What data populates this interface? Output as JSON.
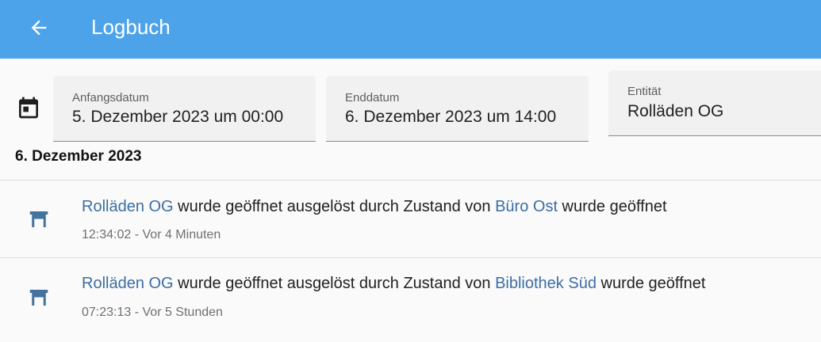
{
  "header": {
    "title": "Logbuch",
    "back_icon": "arrow-left-icon",
    "background": "#4da3ea"
  },
  "filters": {
    "calendar_icon": "calendar-icon",
    "start_label": "Anfangsdatum",
    "start_value": "5. Dezember 2023 um 00:00",
    "end_label": "Enddatum",
    "end_value": "6. Dezember 2023 um 14:00",
    "entity_label": "Entität",
    "entity_value": "Rolläden OG"
  },
  "day_heading": "6. Dezember 2023",
  "entries": [
    {
      "icon": "window-shutter-icon",
      "entity": "Rolläden OG",
      "text_middle": " wurde geöffnet ausgelöst durch Zustand von ",
      "trigger": "Büro Ost",
      "text_end": " wurde geöffnet",
      "time": "12:34:02 - Vor 4 Minuten"
    },
    {
      "icon": "window-shutter-icon",
      "entity": "Rolläden OG",
      "text_middle": " wurde geöffnet ausgelöst durch Zustand von ",
      "trigger": "Bibliothek Süd",
      "text_end": " wurde geöffnet",
      "time": "07:23:13 - Vor 5 Stunden"
    }
  ],
  "colors": {
    "accent": "#4da3ea",
    "link": "#3b6ea5",
    "icon": "#44739e"
  }
}
